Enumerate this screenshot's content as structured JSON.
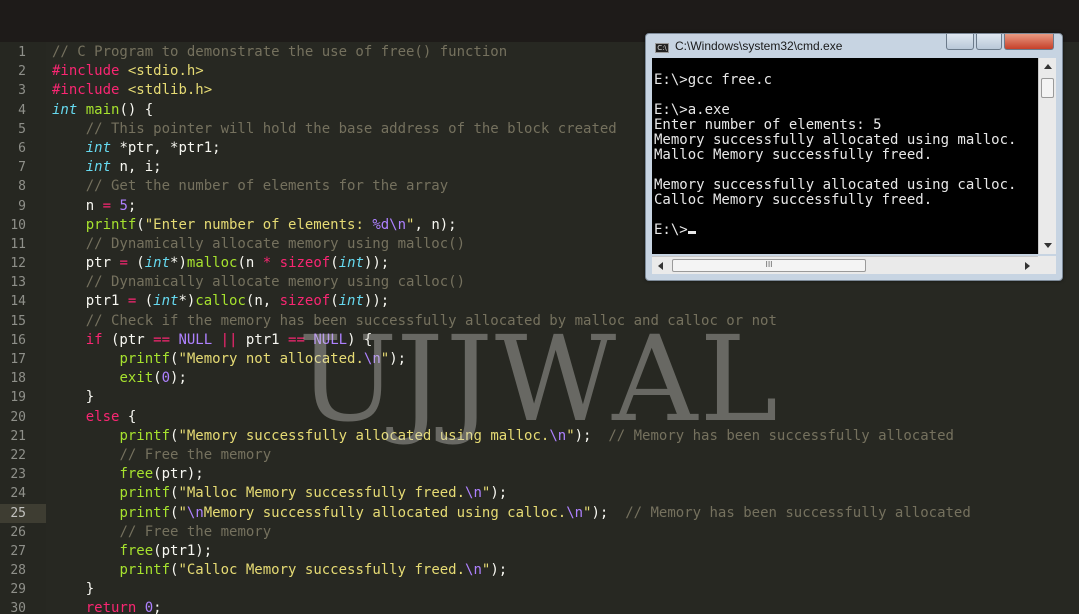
{
  "editor": {
    "lines": [
      {
        "n": "1",
        "html": "<span class='cm'>// C Program to demonstrate the use of free() function</span>"
      },
      {
        "n": "2",
        "html": "<span class='pp'>#include</span> <span class='st'>&lt;stdio.h&gt;</span>"
      },
      {
        "n": "3",
        "html": "<span class='pp'>#include</span> <span class='st'>&lt;stdlib.h&gt;</span>"
      },
      {
        "n": "4",
        "html": "<span class='ty'>int</span> <span class='fn'>main</span>() {"
      },
      {
        "n": "5",
        "html": "    <span class='cm'>// This pointer will hold the base address of the block created</span>"
      },
      {
        "n": "6",
        "html": "    <span class='ty'>int</span> *ptr, *ptr1;"
      },
      {
        "n": "7",
        "html": "    <span class='ty'>int</span> n, i;"
      },
      {
        "n": "8",
        "html": "    <span class='cm'>// Get the number of elements for the array</span>"
      },
      {
        "n": "9",
        "html": "    n <span class='kw'>=</span> <span class='nu'>5</span>;"
      },
      {
        "n": "10",
        "html": "    <span class='fn'>printf</span>(<span class='st'>\"Enter number of elements: </span><span class='es'>%d</span><span class='es'>\\n</span><span class='st'>\"</span>, n);"
      },
      {
        "n": "11",
        "html": "    <span class='cm'>// Dynamically allocate memory using malloc()</span>"
      },
      {
        "n": "12",
        "html": "    ptr <span class='kw'>=</span> (<span class='ty'>int</span>*)<span class='fn'>malloc</span>(n <span class='kw'>*</span> <span class='kw'>sizeof</span>(<span class='ty'>int</span>));"
      },
      {
        "n": "13",
        "html": "    <span class='cm'>// Dynamically allocate memory using calloc()</span>"
      },
      {
        "n": "14",
        "html": "    ptr1 <span class='kw'>=</span> (<span class='ty'>int</span>*)<span class='fn'>calloc</span>(n, <span class='kw'>sizeof</span>(<span class='ty'>int</span>));"
      },
      {
        "n": "15",
        "html": "    <span class='cm'>// Check if the memory has been successfully allocated by malloc and calloc or not</span>"
      },
      {
        "n": "16",
        "html": "    <span class='kw'>if</span> (ptr <span class='kw'>==</span> <span class='es'>NULL</span> <span class='kw'>||</span> ptr1 <span class='kw'>==</span> <span class='es'>NULL</span>) {"
      },
      {
        "n": "17",
        "html": "        <span class='fn'>printf</span>(<span class='st'>\"Memory not allocated.</span><span class='es'>\\n</span><span class='st'>\"</span>);"
      },
      {
        "n": "18",
        "html": "        <span class='fn'>exit</span>(<span class='nu'>0</span>);"
      },
      {
        "n": "19",
        "html": "    }"
      },
      {
        "n": "20",
        "html": "    <span class='kw'>else</span> {"
      },
      {
        "n": "21",
        "html": "        <span class='fn'>printf</span>(<span class='st'>\"Memory successfully allocated using malloc.</span><span class='es'>\\n</span><span class='st'>\"</span>);  <span class='cm'>// Memory has been successfully allocated</span>"
      },
      {
        "n": "22",
        "html": "        <span class='cm'>// Free the memory</span>"
      },
      {
        "n": "23",
        "html": "        <span class='fn'>free</span>(ptr);"
      },
      {
        "n": "24",
        "html": "        <span class='fn'>printf</span>(<span class='st'>\"Malloc Memory successfully freed.</span><span class='es'>\\n</span><span class='st'>\"</span>);"
      },
      {
        "n": "25",
        "html": "        <span class='fn'>printf</span>(<span class='st'>\"</span><span class='es'>\\n</span><span class='st'>Memory successfully allocated using calloc.</span><span class='es'>\\n</span><span class='st'>\"</span>);  <span class='cm'>// Memory has been successfully allocated</span>",
        "active": true
      },
      {
        "n": "26",
        "html": "        <span class='cm'>// Free the memory</span>"
      },
      {
        "n": "27",
        "html": "        <span class='fn'>free</span>(ptr1);"
      },
      {
        "n": "28",
        "html": "        <span class='fn'>printf</span>(<span class='st'>\"Calloc Memory successfully freed.</span><span class='es'>\\n</span><span class='st'>\"</span>);"
      },
      {
        "n": "29",
        "html": "    }"
      },
      {
        "n": "30",
        "html": "    <span class='kw'>return</span> <span class='nu'>0</span>;"
      }
    ]
  },
  "watermark": "UJJWAL",
  "cmd": {
    "title": "C:\\Windows\\system32\\cmd.exe",
    "title_icon": "C:\\",
    "lines": [
      "",
      "E:\\>gcc free.c",
      "",
      "E:\\>a.exe",
      "Enter number of elements: 5",
      "Memory successfully allocated using malloc.",
      "Malloc Memory successfully freed.",
      "",
      "Memory successfully allocated using calloc.",
      "Calloc Memory successfully freed.",
      "",
      "E:\\>"
    ],
    "hscroll_grip": "III"
  },
  "colors": {
    "editor_bg": "#272822",
    "comment": "#75715e",
    "keyword": "#f92672",
    "type": "#66d9ef",
    "function": "#a6e22e",
    "string": "#e6db74",
    "number": "#ae81ff"
  }
}
